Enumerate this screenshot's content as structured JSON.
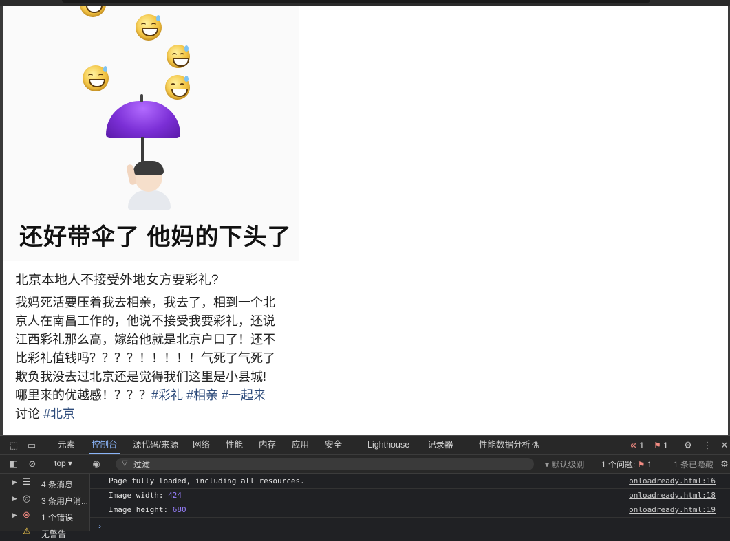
{
  "page": {
    "meme_caption": "还好带伞了 他妈的下头了",
    "post_title": "北京本地人不接受外地女方要彩礼?",
    "post_lines": [
      "我妈死活要压着我去相亲，我去了，相到一个北",
      "京人在南昌工作的，他说不接受我要彩礼，还说",
      "江西彩礼那么高，嫁给他就是北京户口了！还不",
      "比彩礼值钱吗？？？？！！！！！气死了气死了",
      "欺负我没去过北京还是觉得我们这里是小县城!"
    ],
    "post_line6_text": "哪里来的优越感！？？？",
    "post_line6_tags": "#彩礼 #相亲 #一起来",
    "post_line7_text": "讨论",
    "post_line7_tags": "#北京"
  },
  "devtools": {
    "tabs": [
      "元素",
      "控制台",
      "源代码/来源",
      "网络",
      "性能",
      "内存",
      "应用",
      "安全",
      "Lighthouse",
      "记录器",
      "性能数据分析"
    ],
    "active_tab": "控制台",
    "error_count": "1",
    "issue_count": "1",
    "context": "top",
    "filter_placeholder": "过滤",
    "level": "默认级别",
    "issues_label": "1 个问题:",
    "issues_badge": "1",
    "hidden_label": "1 条已隐藏",
    "sidebar": [
      {
        "label": "4 条消息",
        "icon": "list-icon"
      },
      {
        "label": "3 条用户消...",
        "icon": "user-icon"
      },
      {
        "label": "1 个错误",
        "icon": "error-icon"
      },
      {
        "label": "无警告",
        "icon": "warning-icon"
      }
    ],
    "messages": [
      {
        "text": "Page fully loaded, including all resources.",
        "value": "",
        "source": "onloadready.html:16"
      },
      {
        "text": "Image width: ",
        "value": "424",
        "source": "onloadready.html:18"
      },
      {
        "text": "Image height: ",
        "value": "680",
        "source": "onloadready.html:19"
      }
    ]
  }
}
